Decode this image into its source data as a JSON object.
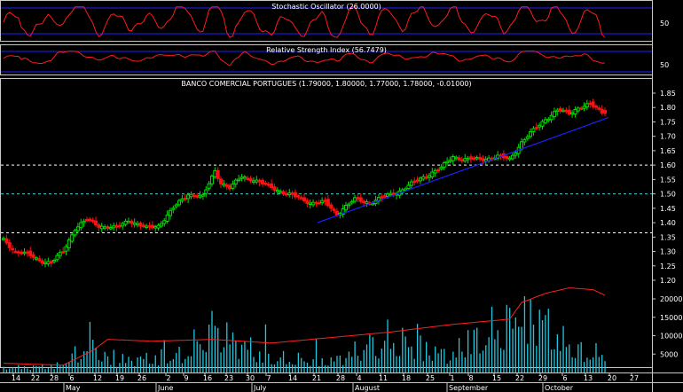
{
  "colors": {
    "background": "#000000",
    "frame": "#c8c8c8",
    "up_candle": "#00e000",
    "down_candle": "#ff1010",
    "indicator_line": "#ff1a1a",
    "band_line": "#2020ff",
    "trendline": "#2020ff",
    "volume_bar": "#1ec8e0",
    "volume_line": "#ff2020",
    "white_dashed": "#ffffff",
    "cyan_dashed": "#20e0e0",
    "text": "#ffffff"
  },
  "panels": {
    "stochastic": {
      "title": "Stochastic Oscillator (26.0000)",
      "tick_labels": [
        "50"
      ]
    },
    "rsi": {
      "title": "Relative Strength Index (56.7479)",
      "tick_labels": [
        "50"
      ]
    },
    "price": {
      "title": "BANCO COMERCIAL PORTUGUES (1.79000, 1.80000, 1.77000, 1.78000, -0.01000)",
      "tick_labels": [
        "1.85",
        "1.80",
        "1.75",
        "1.70",
        "1.65",
        "1.60",
        "1.55",
        "1.50",
        "1.45",
        "1.40",
        "1.35",
        "1.30",
        "1.25",
        "1.20"
      ]
    },
    "volume": {
      "tick_labels": [
        "20000",
        "15000",
        "10000",
        "5000"
      ]
    }
  },
  "x_axis": {
    "day_labels": [
      "14",
      "22",
      "28",
      "6",
      "12",
      "19",
      "26",
      "2",
      "9",
      "16",
      "23",
      "30",
      "7",
      "14",
      "21",
      "28",
      "4",
      "11",
      "18",
      "25",
      "1",
      "8",
      "15",
      "22",
      "29",
      "6",
      "13",
      "20",
      "27"
    ],
    "month_labels": [
      "May",
      "June",
      "July",
      "August",
      "September",
      "October"
    ]
  },
  "chart_data": {
    "type": "candlestick",
    "title": "BANCO COMERCIAL PORTUGUES (1.79000, 1.80000, 1.77000, 1.78000, -0.01000)",
    "last_bar": {
      "open": 1.79,
      "high": 1.8,
      "low": 1.77,
      "close": 1.78,
      "change": -0.01
    },
    "price_range": [
      1.15,
      1.875
    ],
    "horizontal_levels": [
      {
        "value": 1.6,
        "style": "white-dashed"
      },
      {
        "value": 1.5,
        "style": "cyan-dashed"
      },
      {
        "value": 1.365,
        "style": "white-dashed"
      }
    ],
    "trendline": {
      "from_close": 1.4,
      "to_close": 1.765
    },
    "close_anchors": [
      [
        0,
        1.34
      ],
      [
        4,
        1.3
      ],
      [
        8,
        1.29
      ],
      [
        12,
        1.27
      ],
      [
        16,
        1.26
      ],
      [
        20,
        1.3
      ],
      [
        24,
        1.38
      ],
      [
        28,
        1.41
      ],
      [
        32,
        1.39
      ],
      [
        38,
        1.38
      ],
      [
        42,
        1.41
      ],
      [
        48,
        1.38
      ],
      [
        52,
        1.39
      ],
      [
        57,
        1.45
      ],
      [
        62,
        1.5
      ],
      [
        67,
        1.49
      ],
      [
        71,
        1.58
      ],
      [
        73,
        1.54
      ],
      [
        76,
        1.52
      ],
      [
        80,
        1.56
      ],
      [
        84,
        1.55
      ],
      [
        88,
        1.53
      ],
      [
        93,
        1.51
      ],
      [
        98,
        1.49
      ],
      [
        103,
        1.47
      ],
      [
        108,
        1.47
      ],
      [
        112,
        1.43
      ],
      [
        114,
        1.45
      ],
      [
        118,
        1.48
      ],
      [
        123,
        1.47
      ],
      [
        128,
        1.49
      ],
      [
        133,
        1.51
      ],
      [
        138,
        1.54
      ],
      [
        143,
        1.57
      ],
      [
        147,
        1.59
      ],
      [
        151,
        1.63
      ],
      [
        155,
        1.62
      ],
      [
        160,
        1.62
      ],
      [
        166,
        1.63
      ],
      [
        170,
        1.62
      ],
      [
        174,
        1.68
      ],
      [
        178,
        1.72
      ],
      [
        182,
        1.76
      ],
      [
        186,
        1.79
      ],
      [
        190,
        1.78
      ],
      [
        193,
        1.8
      ],
      [
        197,
        1.81
      ],
      [
        200,
        1.79
      ],
      [
        202,
        1.78
      ]
    ],
    "bar_count": 203,
    "volume_range": [
      0,
      25000
    ],
    "volume_profile": [
      [
        0,
        1500
      ],
      [
        20,
        2500
      ],
      [
        30,
        12000
      ],
      [
        35,
        4000
      ],
      [
        60,
        6000
      ],
      [
        70,
        15000
      ],
      [
        90,
        5000
      ],
      [
        110,
        4000
      ],
      [
        130,
        12000
      ],
      [
        150,
        6000
      ],
      [
        170,
        18000
      ],
      [
        180,
        20000
      ],
      [
        190,
        8000
      ],
      [
        202,
        6000
      ]
    ],
    "volume_avg_line": [
      [
        0,
        2500
      ],
      [
        20,
        2000
      ],
      [
        30,
        6000
      ],
      [
        35,
        9000
      ],
      [
        50,
        8500
      ],
      [
        70,
        9000
      ],
      [
        90,
        8000
      ],
      [
        110,
        9500
      ],
      [
        130,
        11000
      ],
      [
        150,
        13000
      ],
      [
        170,
        14500
      ],
      [
        174,
        19000
      ],
      [
        182,
        21500
      ],
      [
        190,
        23000
      ],
      [
        198,
        22500
      ],
      [
        202,
        21000
      ]
    ],
    "stochastic_range": [
      0,
      100
    ],
    "stochastic_bands": [
      20,
      80
    ],
    "rsi_range": [
      0,
      100
    ],
    "rsi_bands": [
      30,
      70
    ],
    "rsi_last": 56.7479,
    "stochastic_last": 26.0
  }
}
